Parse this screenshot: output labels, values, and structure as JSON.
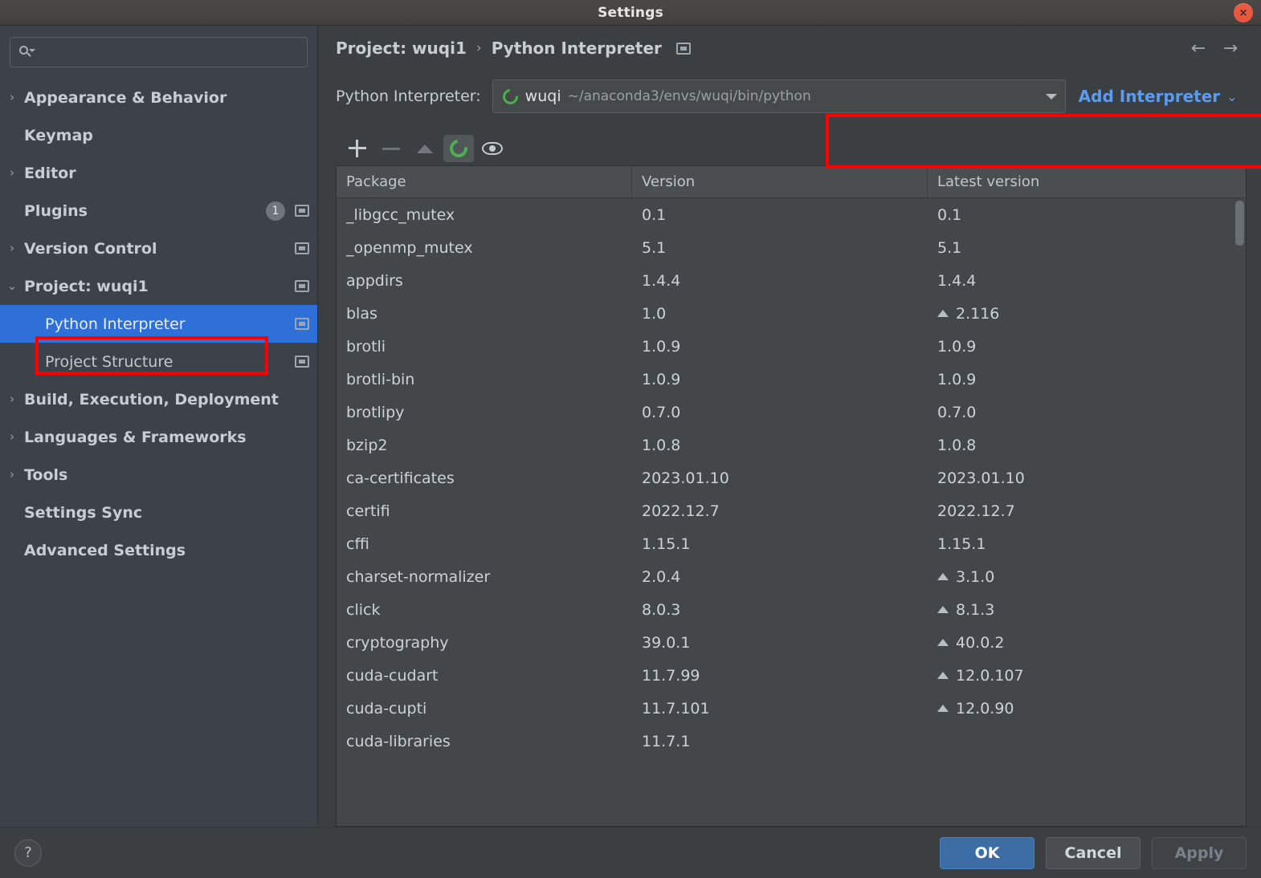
{
  "window": {
    "title": "Settings",
    "close_label": "×"
  },
  "sidebar": {
    "search": {
      "value": "",
      "placeholder": ""
    },
    "items": [
      {
        "label": "Appearance & Behavior",
        "arrow": "›",
        "child": false,
        "badge": "",
        "copy": false,
        "selected": false
      },
      {
        "label": "Keymap",
        "arrow": "",
        "child": false,
        "badge": "",
        "copy": false,
        "selected": false
      },
      {
        "label": "Editor",
        "arrow": "›",
        "child": false,
        "badge": "",
        "copy": false,
        "selected": false
      },
      {
        "label": "Plugins",
        "arrow": "",
        "child": false,
        "badge": "1",
        "copy": true,
        "selected": false
      },
      {
        "label": "Version Control",
        "arrow": "›",
        "child": false,
        "badge": "",
        "copy": true,
        "selected": false
      },
      {
        "label": "Project: wuqi1",
        "arrow": "⌄",
        "child": false,
        "badge": "",
        "copy": true,
        "selected": false
      },
      {
        "label": "Python Interpreter",
        "arrow": "",
        "child": true,
        "badge": "",
        "copy": true,
        "selected": true
      },
      {
        "label": "Project Structure",
        "arrow": "",
        "child": true,
        "badge": "",
        "copy": true,
        "selected": false
      },
      {
        "label": "Build, Execution, Deployment",
        "arrow": "›",
        "child": false,
        "badge": "",
        "copy": false,
        "selected": false
      },
      {
        "label": "Languages & Frameworks",
        "arrow": "›",
        "child": false,
        "badge": "",
        "copy": false,
        "selected": false
      },
      {
        "label": "Tools",
        "arrow": "›",
        "child": false,
        "badge": "",
        "copy": false,
        "selected": false
      },
      {
        "label": "Settings Sync",
        "arrow": "",
        "child": false,
        "badge": "",
        "copy": false,
        "selected": false
      },
      {
        "label": "Advanced Settings",
        "arrow": "",
        "child": false,
        "badge": "",
        "copy": false,
        "selected": false
      }
    ]
  },
  "breadcrumb": {
    "project": "Project: wuqi1",
    "separator": "›",
    "page": "Python Interpreter"
  },
  "nav": {
    "back": "←",
    "forward": "→"
  },
  "interpreter": {
    "label": "Python Interpreter:",
    "selected_name": "wuqi",
    "selected_path": "~/anaconda3/envs/wuqi/bin/python",
    "add_label": "Add Interpreter",
    "add_chevron": "⌄"
  },
  "packages_toolbar": {
    "add": "+",
    "remove": "−",
    "upgrade": "▲",
    "conda": "conda-refresh",
    "eye": "show-early-releases"
  },
  "packages_table": {
    "columns": [
      "Package",
      "Version",
      "Latest version"
    ],
    "rows": [
      {
        "package": "_libgcc_mutex",
        "version": "0.1",
        "latest": "0.1",
        "upgradable": false
      },
      {
        "package": "_openmp_mutex",
        "version": "5.1",
        "latest": "5.1",
        "upgradable": false
      },
      {
        "package": "appdirs",
        "version": "1.4.4",
        "latest": "1.4.4",
        "upgradable": false
      },
      {
        "package": "blas",
        "version": "1.0",
        "latest": "2.116",
        "upgradable": true
      },
      {
        "package": "brotli",
        "version": "1.0.9",
        "latest": "1.0.9",
        "upgradable": false
      },
      {
        "package": "brotli-bin",
        "version": "1.0.9",
        "latest": "1.0.9",
        "upgradable": false
      },
      {
        "package": "brotlipy",
        "version": "0.7.0",
        "latest": "0.7.0",
        "upgradable": false
      },
      {
        "package": "bzip2",
        "version": "1.0.8",
        "latest": "1.0.8",
        "upgradable": false
      },
      {
        "package": "ca-certificates",
        "version": "2023.01.10",
        "latest": "2023.01.10",
        "upgradable": false
      },
      {
        "package": "certifi",
        "version": "2022.12.7",
        "latest": "2022.12.7",
        "upgradable": false
      },
      {
        "package": "cffi",
        "version": "1.15.1",
        "latest": "1.15.1",
        "upgradable": false
      },
      {
        "package": "charset-normalizer",
        "version": "2.0.4",
        "latest": "3.1.0",
        "upgradable": true
      },
      {
        "package": "click",
        "version": "8.0.3",
        "latest": "8.1.3",
        "upgradable": true
      },
      {
        "package": "cryptography",
        "version": "39.0.1",
        "latest": "40.0.2",
        "upgradable": true
      },
      {
        "package": "cuda-cudart",
        "version": "11.7.99",
        "latest": "12.0.107",
        "upgradable": true
      },
      {
        "package": "cuda-cupti",
        "version": "11.7.101",
        "latest": "12.0.90",
        "upgradable": true
      },
      {
        "package": "cuda-libraries",
        "version": "11.7.1",
        "latest": "",
        "upgradable": false
      }
    ]
  },
  "footer": {
    "help": "?",
    "ok": "OK",
    "cancel": "Cancel",
    "apply": "Apply"
  },
  "colors": {
    "accent_blue": "#2f6fd8",
    "link_blue": "#5b9bf0",
    "annotation_red": "#ff0000",
    "conda_green": "#4caf50",
    "ok_button": "#3c6ea5"
  }
}
